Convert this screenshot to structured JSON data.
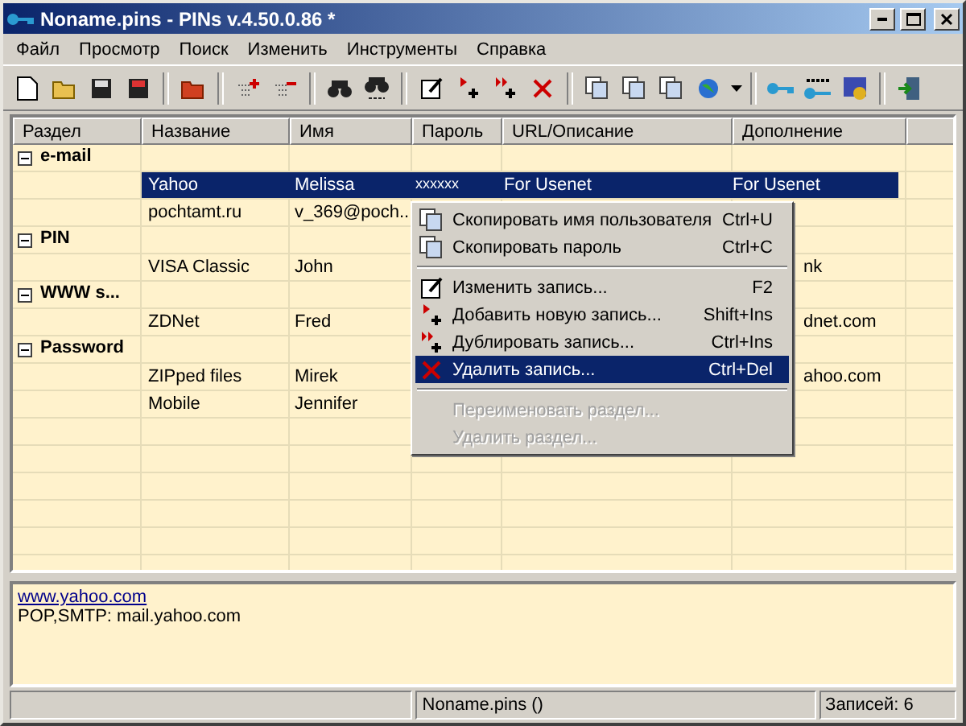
{
  "window": {
    "title": "Noname.pins - PINs v.4.50.0.86 *"
  },
  "menu_bar": [
    "Файл",
    "Просмотр",
    "Поиск",
    "Изменить",
    "Инструменты",
    "Справка"
  ],
  "table": {
    "columns": [
      "Раздел",
      "Название",
      "Имя",
      "Пароль",
      "URL/Описание",
      "Дополнение"
    ],
    "groups": [
      {
        "name": "e-mail",
        "expanded": true,
        "entries": [
          {
            "title": "Yahoo",
            "name": "Melissa",
            "password": "xxxxxx",
            "url": "For Usenet",
            "extra": "For Usenet",
            "selected": true
          },
          {
            "title": "pochtamt.ru",
            "name": "v_369@poch...",
            "selected": false
          }
        ]
      },
      {
        "name": "PIN",
        "expanded": true,
        "entries": [
          {
            "title": "VISA Classic",
            "name": "John",
            "extra": "nk",
            "selected": false
          }
        ]
      },
      {
        "name": "WWW s...",
        "expanded": true,
        "entries": [
          {
            "title": "ZDNet",
            "name": "Fred",
            "extra": "dnet.com",
            "selected": false
          }
        ]
      },
      {
        "name": "Password",
        "expanded": true,
        "entries": [
          {
            "title": "ZIPped files",
            "name": "Mirek",
            "extra": "ahoo.com",
            "selected": false
          },
          {
            "title": "Mobile",
            "name": "Jennifer",
            "selected": false
          }
        ]
      }
    ]
  },
  "context_menu": [
    {
      "kind": "item",
      "label": "Скопировать имя пользователя",
      "shortcut": "Ctrl+U",
      "disabled": false,
      "selected": false
    },
    {
      "kind": "item",
      "label": "Скопировать пароль",
      "shortcut": "Ctrl+C",
      "disabled": false,
      "selected": false
    },
    {
      "kind": "separator"
    },
    {
      "kind": "item",
      "label": "Изменить запись...",
      "shortcut": "F2",
      "disabled": false,
      "selected": false
    },
    {
      "kind": "item",
      "label": "Добавить новую запись...",
      "shortcut": "Shift+Ins",
      "disabled": false,
      "selected": false
    },
    {
      "kind": "item",
      "label": "Дублировать запись...",
      "shortcut": "Ctrl+Ins",
      "disabled": false,
      "selected": false
    },
    {
      "kind": "item",
      "label": "Удалить запись...",
      "shortcut": "Ctrl+Del",
      "disabled": false,
      "selected": true
    },
    {
      "kind": "separator"
    },
    {
      "kind": "item",
      "label": "Переименовать раздел...",
      "disabled": true,
      "selected": false
    },
    {
      "kind": "item",
      "label": "Удалить раздел...",
      "disabled": true,
      "selected": false
    }
  ],
  "notes": {
    "link": "www.yahoo.com",
    "text": "POP,SMTP: mail.yahoo.com"
  },
  "status_bar": [
    "Noname.pins ()",
    "Записей: 6"
  ]
}
